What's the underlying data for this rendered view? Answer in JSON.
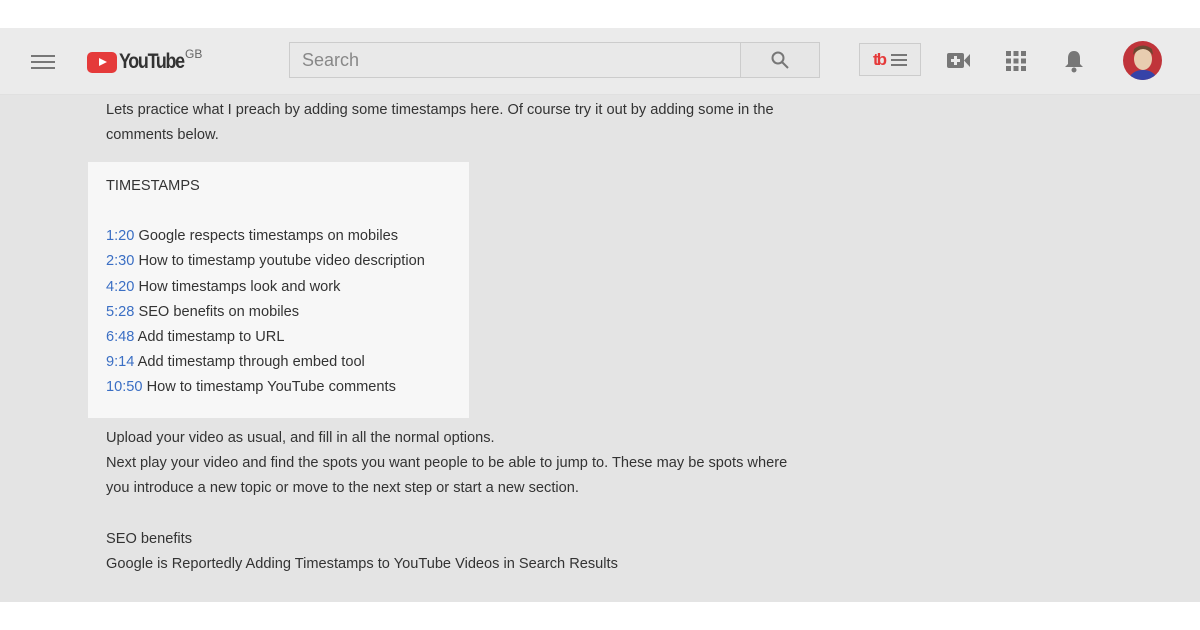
{
  "header": {
    "logo_text": "YouTube",
    "region": "GB",
    "search_placeholder": "Search",
    "colors": {
      "brand": "#e53a3a",
      "link": "#3b6fc4"
    }
  },
  "icons": [
    "menu-icon",
    "search-icon",
    "tubebuddy-icon",
    "create-video-icon",
    "apps-icon",
    "notifications-icon",
    "avatar"
  ],
  "tubebuddy": {
    "label": "tb"
  },
  "intro": [
    "Lets practice what I preach by adding some timestamps here. Of course try it out by adding some in the",
    "comments below."
  ],
  "timestamps": {
    "heading": "TIMESTAMPS",
    "items": [
      {
        "time": "1:20",
        "label": "Google respects timestamps on mobiles"
      },
      {
        "time": "2:30",
        "label": "How to timestamp youtube video description"
      },
      {
        "time": "4:20",
        "label": "How timestamps look and work"
      },
      {
        "time": "5:28",
        "label": "SEO benefits on mobiles"
      },
      {
        "time": "6:48",
        "label": "Add timestamp to URL"
      },
      {
        "time": "9:14",
        "label": "Add timestamp through embed tool"
      },
      {
        "time": "10:50",
        "label": "How to timestamp YouTube comments"
      }
    ]
  },
  "body": [
    "Upload your video as usual, and fill in all the normal options.",
    "Next play your video and find the spots you want people to be able to jump to. These may be spots where",
    "you introduce a new topic or move to the next step or start a new section."
  ],
  "seo": {
    "heading": "SEO benefits",
    "text": "Google is Reportedly Adding Timestamps to YouTube Videos in Search Results"
  }
}
